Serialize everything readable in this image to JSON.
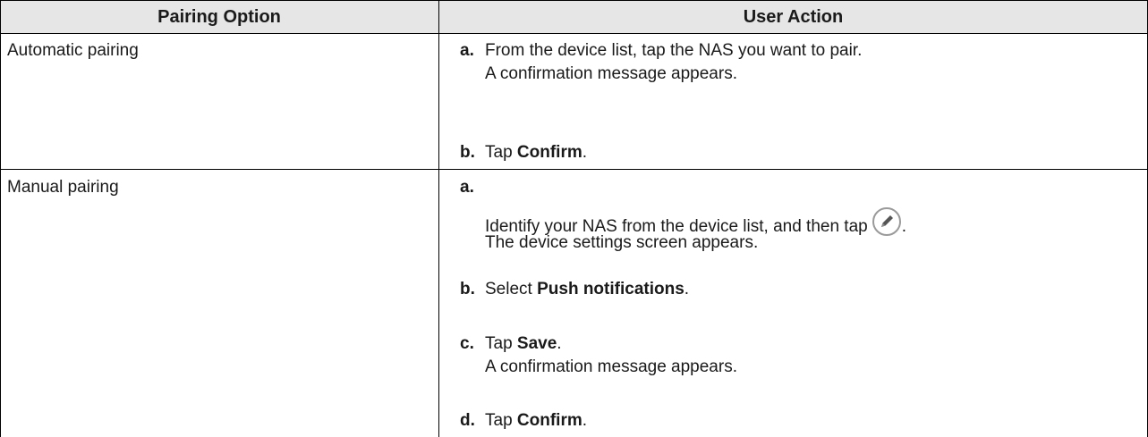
{
  "table": {
    "headers": [
      "Pairing Option",
      "User Action"
    ],
    "rows": [
      {
        "option": "Automatic pairing",
        "steps": [
          {
            "label": "a.",
            "pre": "From the device list, tap the NAS you want to pair.",
            "bold": "",
            "post": "",
            "sub": "A confirmation message appears."
          },
          {
            "label": "b.",
            "pre": "Tap ",
            "bold": "Confirm",
            "post": ".",
            "sub": ""
          }
        ]
      },
      {
        "option": "Manual pairing",
        "steps": [
          {
            "label": "a.",
            "pre": "Identify your NAS from the device list, and then tap",
            "bold": "",
            "post": ".",
            "sub": "The device settings screen appears.",
            "icon": "edit-pencil-icon"
          },
          {
            "label": "b.",
            "pre": "Select ",
            "bold": "Push notifications",
            "post": ".",
            "sub": ""
          },
          {
            "label": "c.",
            "pre": "Tap ",
            "bold": "Save",
            "post": ".",
            "sub": "A confirmation message appears."
          },
          {
            "label": "d.",
            "pre": "Tap ",
            "bold": "Confirm",
            "post": ".",
            "sub": ""
          }
        ]
      }
    ]
  }
}
